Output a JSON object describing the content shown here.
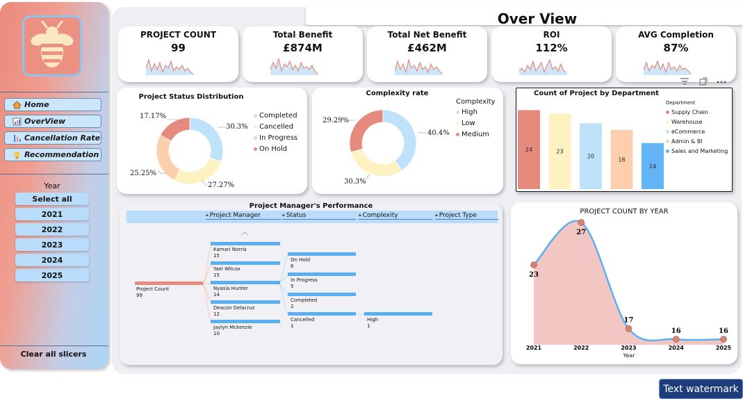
{
  "title": "Over View",
  "nav": [
    {
      "label": "Home",
      "icon": "home-icon"
    },
    {
      "label": "OverView",
      "icon": "overview-icon"
    },
    {
      "label": "Cancellation Rate",
      "icon": "cancellation-icon"
    },
    {
      "label": "Recommendation",
      "icon": "recommendation-icon"
    }
  ],
  "slicer": {
    "title": "Year",
    "options": [
      "Select all",
      "2021",
      "2022",
      "2023",
      "2024",
      "2025"
    ],
    "clear_label": "Clear all slicers"
  },
  "kpis": [
    {
      "label": "PROJECT COUNT",
      "value": "99"
    },
    {
      "label": "Total Benefit",
      "value": "£874M"
    },
    {
      "label": "Total Net Benefit",
      "value": "£462M"
    },
    {
      "label": "ROI",
      "value": "112%"
    },
    {
      "label": "AVG Completion",
      "value": "87%"
    }
  ],
  "visual_menu_icon": "more-options-icon",
  "chart_data": [
    {
      "type": "pie",
      "title": "Project Status Distribution",
      "categories": [
        "Completed",
        "Cancelled",
        "In Progress",
        "On Hold"
      ],
      "values": [
        30.3,
        27.27,
        25.25,
        17.17
      ],
      "labels": [
        "30.3%",
        "27.27%",
        "25.25%",
        "17.17%"
      ],
      "colors": [
        "#bfe2fb",
        "#fef2c2",
        "#fdcfad",
        "#e58a7c"
      ],
      "legend_position": "right"
    },
    {
      "type": "pie",
      "title": "Complexity rate",
      "legend_title": "Complexity",
      "categories": [
        "High",
        "Low",
        "Medium"
      ],
      "values": [
        40.4,
        30.3,
        29.29
      ],
      "labels": [
        "40.4%",
        "30.3%",
        "29.29%"
      ],
      "colors": [
        "#bfe2fb",
        "#fef2c2",
        "#e58a7c"
      ],
      "legend_position": "right"
    },
    {
      "type": "bar",
      "title": "Count of Project by Department",
      "legend_title": "Department",
      "categories": [
        "Supply Chain",
        "Warehouse",
        "eCommerce",
        "Admin & BI",
        "Sales and Marketing"
      ],
      "values": [
        24,
        23,
        20,
        18,
        14
      ],
      "colors": [
        "#e58a7c",
        "#fef2c2",
        "#bfe2fb",
        "#fdcfad",
        "#62b4f5"
      ],
      "ylim": [
        0,
        26
      ],
      "legend_position": "right"
    },
    {
      "type": "area",
      "title": "PROJECT COUNT BY YEAR",
      "xlabel": "Year",
      "x": [
        "2021",
        "2022",
        "2023",
        "2024",
        "2025"
      ],
      "values": [
        23,
        27,
        17,
        16,
        16
      ],
      "labels": [
        "23",
        "27",
        "17",
        "16",
        "16"
      ],
      "ylim": [
        16,
        27
      ],
      "colors": [
        "#5aaef2",
        "#f2c6c2",
        "#d48472"
      ]
    }
  ],
  "decomposition_tree": {
    "title": "Project Manager's Performance",
    "columns": [
      "Project Manager",
      "Status",
      "Complexity",
      "Project Type"
    ],
    "root": {
      "label": "Project Count",
      "value": "99"
    },
    "managers": [
      {
        "label": "Kamari Norris",
        "value": "15"
      },
      {
        "label": "Yael Wilcox",
        "value": "15"
      },
      {
        "label": "Nyasia Hunter",
        "value": "14"
      },
      {
        "label": "Deacon Delacruz",
        "value": "12"
      },
      {
        "label": "Jaylyn Mckenzie",
        "value": "10"
      }
    ],
    "statuses": [
      {
        "label": "On Hold",
        "value": "6"
      },
      {
        "label": "In Progress",
        "value": "5"
      },
      {
        "label": "Completed",
        "value": "2"
      },
      {
        "label": "Cancelled",
        "value": "1"
      }
    ],
    "complexity": [
      {
        "label": "High",
        "value": "1"
      }
    ]
  },
  "watermark": "Text watermark"
}
